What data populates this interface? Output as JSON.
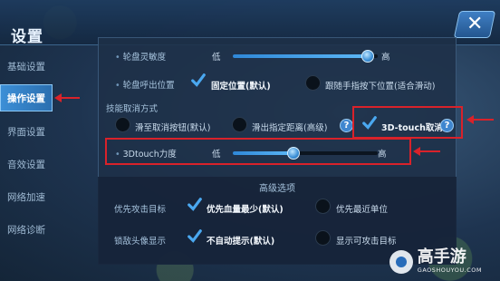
{
  "header": {
    "title": "设置"
  },
  "sidebar": {
    "items": [
      {
        "label": "基础设置"
      },
      {
        "label": "操作设置"
      },
      {
        "label": "界面设置"
      },
      {
        "label": "音效设置"
      },
      {
        "label": "网络加速"
      },
      {
        "label": "网络诊断"
      }
    ],
    "active_index": 1
  },
  "settings": {
    "wheel_sensitivity": {
      "label": "轮盘灵敏度",
      "low": "低",
      "high": "高",
      "value": 0.93
    },
    "wheel_position": {
      "label": "轮盘呼出位置",
      "option_fixed": "固定位置(默认)",
      "option_follow": "跟随手指按下位置(适合滑动)",
      "selected": "fixed"
    },
    "cancel_method": {
      "label": "技能取消方式",
      "option_button": "滑至取消按钮(默认)",
      "option_distance": "滑出指定距离(高级)",
      "option_3dtouch": "3D-touch取消",
      "selected": "3dtouch",
      "help_icon": "?"
    },
    "touch_force": {
      "label": "3Dtouch力度",
      "low": "低",
      "high": "高",
      "value": 0.42
    }
  },
  "advanced": {
    "title": "高级选项",
    "attack_target": {
      "label": "优先攻击目标",
      "option_lowhp": "优先血量最少(默认)",
      "option_nearest": "优先最近单位",
      "selected": "lowhp"
    },
    "lock_portrait": {
      "label": "锁敌头像显示",
      "option_noauto": "不自动提示(默认)",
      "option_show": "显示可攻击目标",
      "selected": "noauto"
    }
  },
  "watermark": {
    "main": "高手游",
    "sub": "GAOSHOUYOU.COM"
  },
  "colors": {
    "accent": "#3c8fd6",
    "annotation": "#d9222a",
    "checkmark": "#4aa8f0"
  }
}
